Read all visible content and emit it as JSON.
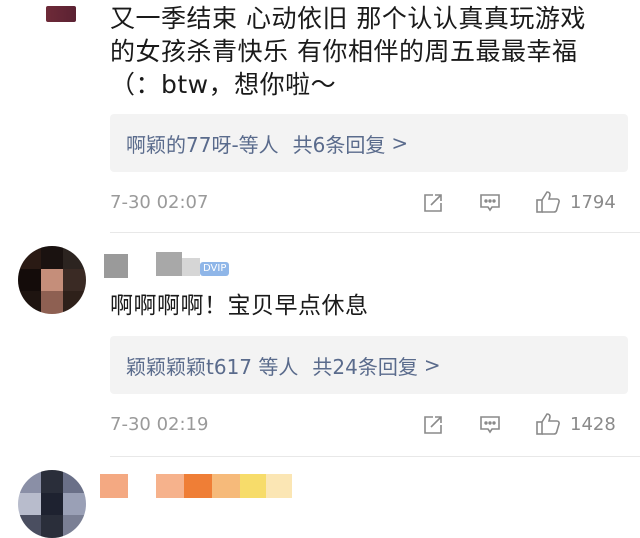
{
  "comments": [
    {
      "text_lines": [
        "又一季结束 心动依旧 那个认认真真玩游戏",
        "的女孩杀青快乐 有你相伴的周五最最幸福",
        "（：btw，想你啦～"
      ],
      "reply_preview": {
        "names": "啊颖的77呀-等人",
        "count": "共6条回复",
        "chevron": ">"
      },
      "timestamp": "7-30 02:07",
      "likes": "1794"
    },
    {
      "badge": "DVIP",
      "text": "啊啊啊啊！宝贝早点休息",
      "reply_preview": {
        "names": "颖颖颖颖t617 等人",
        "count": "共24条回复",
        "chevron": ">"
      },
      "timestamp": "7-30 02:19",
      "likes": "1428"
    }
  ],
  "icons": {
    "forward": "forward-icon",
    "comment": "comment-icon",
    "like": "thumbs-up-icon"
  },
  "colors": {
    "reply_link": "#5a6b8c",
    "reply_bg": "#f3f3f3",
    "meta": "#9a9a9a"
  }
}
